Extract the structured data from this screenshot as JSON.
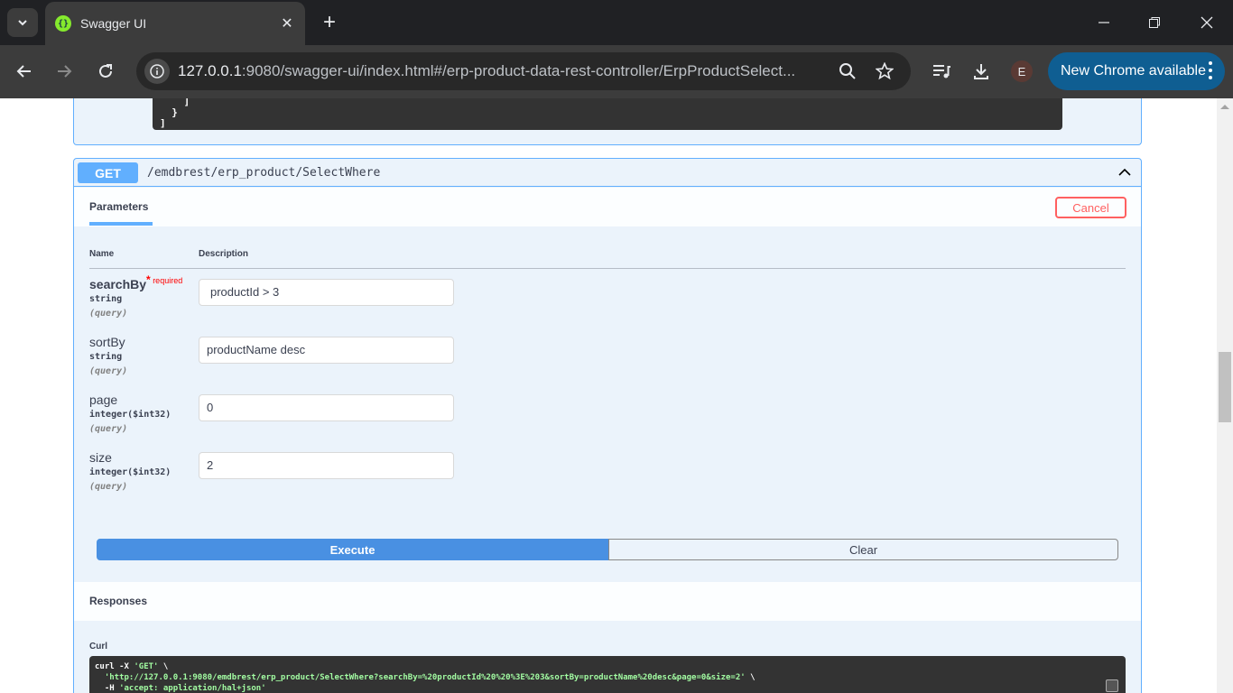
{
  "browser": {
    "tab_title": "Swagger UI",
    "url_host": "127.0.0.1",
    "url_rest": ":9080/swagger-ui/index.html#/erp-product-data-rest-controller/ErpProductSelect...",
    "profile_initial": "E",
    "update_label": "New Chrome available"
  },
  "prev_code": "    ]\n  }\n]",
  "operation": {
    "method": "GET",
    "path": "/emdbrest/erp_product/SelectWhere",
    "params_tab": "Parameters",
    "cancel_label": "Cancel",
    "col_name": "Name",
    "col_description": "Description",
    "required_label": "required",
    "params": [
      {
        "name": "searchBy",
        "type": "string",
        "in": "(query)",
        "value": " productId  > 3",
        "required": true
      },
      {
        "name": "sortBy",
        "type": "string",
        "in": "(query)",
        "value": "productName desc",
        "required": false
      },
      {
        "name": "page",
        "type": "integer($int32)",
        "in": "(query)",
        "value": "0",
        "required": false
      },
      {
        "name": "size",
        "type": "integer($int32)",
        "in": "(query)",
        "value": "2",
        "required": false
      }
    ],
    "execute_label": "Execute",
    "clear_label": "Clear",
    "responses_title": "Responses",
    "curl_label": "Curl",
    "curl": {
      "line1_prefix": "curl -X ",
      "line1_method": "'GET'",
      "line1_suffix": " \\",
      "line2_url": "'http://127.0.0.1:9080/emdbrest/erp_product/SelectWhere?searchBy=%20productId%20%20%3E%203&sortBy=productName%20desc&page=0&size=2'",
      "line2_suffix": " \\",
      "line3_prefix": "  -H ",
      "line3_header": "'accept: application/hal+json'"
    }
  },
  "colors": {
    "get_accent": "#61affe",
    "execute": "#4990e2",
    "cancel": "#ff6060"
  }
}
